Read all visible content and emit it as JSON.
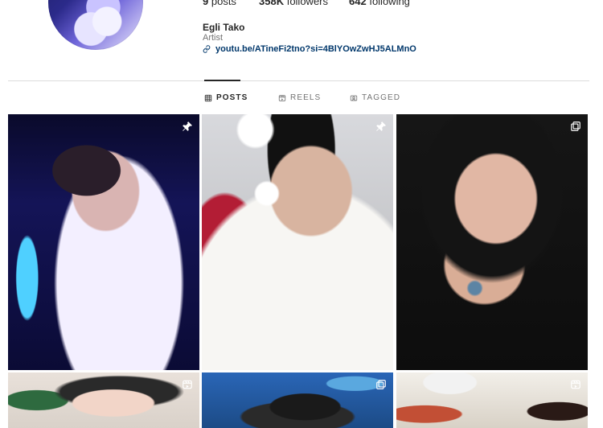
{
  "profile": {
    "stats": {
      "posts_count": "9",
      "posts_label": "posts",
      "followers_count": "358K",
      "followers_label": "followers",
      "following_count": "642",
      "following_label": "following"
    },
    "name": "Egli Tako",
    "category": "Artist",
    "link": "youtu.be/ATineFi2tno?si=4BlYOwZwHJ5ALMnO"
  },
  "tabs": [
    {
      "label": "POSTS",
      "icon": "grid-icon",
      "active": true
    },
    {
      "label": "REELS",
      "icon": "reels-icon",
      "active": false
    },
    {
      "label": "TAGGED",
      "icon": "tagged-icon",
      "active": false
    }
  ],
  "grid": {
    "items": [
      {
        "badge": "pin-icon"
      },
      {
        "badge": "pin-icon"
      },
      {
        "badge": "carousel-icon"
      },
      {
        "badge": "reels-icon"
      },
      {
        "badge": "carousel-icon"
      },
      {
        "badge": "reels-icon"
      }
    ]
  },
  "colors": {
    "text": "#262626",
    "muted": "#737373",
    "link": "#00376b",
    "divider": "#dbdbdb"
  }
}
